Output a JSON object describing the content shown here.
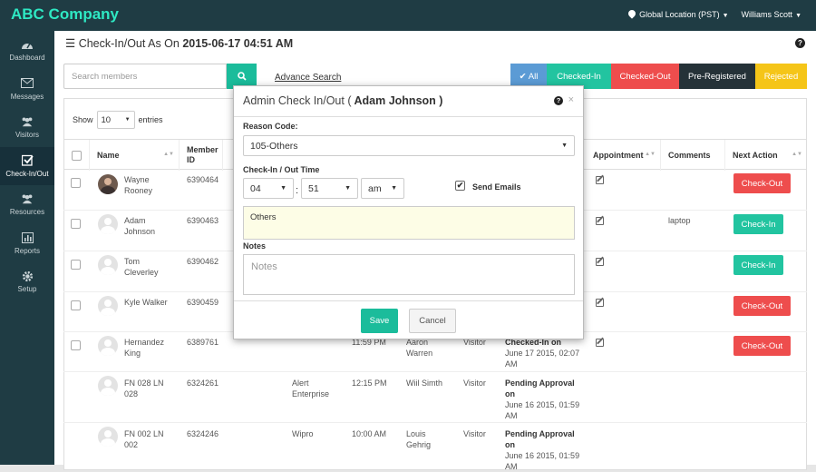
{
  "app": {
    "brand": "ABC Company",
    "location": "Global Location (PST)",
    "user": "Williams Scott"
  },
  "sidebar": {
    "items": [
      {
        "label": "Dashboard",
        "icon": "dashboard-icon"
      },
      {
        "label": "Messages",
        "icon": "envelope-icon"
      },
      {
        "label": "Visitors",
        "icon": "users-icon"
      },
      {
        "label": "Check-In/Out",
        "icon": "checkbox-icon"
      },
      {
        "label": "Resources",
        "icon": "resources-icon"
      },
      {
        "label": "Reports",
        "icon": "bar-chart-icon"
      },
      {
        "label": "Setup",
        "icon": "gear-icon"
      }
    ]
  },
  "page": {
    "title_prefix": "Check-In/Out As On",
    "title_datetime": "2015-06-17 04:51 AM"
  },
  "search": {
    "placeholder": "Search members",
    "advance_label": "Advance Search"
  },
  "filters": [
    {
      "label": "✔ All",
      "color": "#5b9bd5"
    },
    {
      "label": "Checked-In",
      "color": "#22c4a0"
    },
    {
      "label": "Checked-Out",
      "color": "#ee4d4d"
    },
    {
      "label": "Pre-Registered",
      "color": "#253238"
    },
    {
      "label": "Rejected",
      "color": "#f5c518"
    }
  ],
  "table": {
    "show_label": "Show",
    "entries_value": "10",
    "entries_label": "entries",
    "headers": {
      "name": "Name",
      "member_id": "Member ID",
      "appointment": "Appointment",
      "comments": "Comments",
      "next_action": "Next Action"
    },
    "rows": [
      {
        "name": "Wayne Rooney",
        "id": "6390464",
        "company": "",
        "time": "",
        "host": "",
        "type": "",
        "status": "",
        "status_date": "",
        "comment": "",
        "action": "Check-Out"
      },
      {
        "name": "Adam Johnson",
        "id": "6390463",
        "company": "",
        "time": "",
        "host": "",
        "type": "",
        "status": "",
        "status_date": "",
        "comment": "laptop",
        "action": "Check-In"
      },
      {
        "name": "Tom Cleverley",
        "id": "6390462",
        "company": "",
        "time": "",
        "host": "",
        "type": "",
        "status": "",
        "status_date": "",
        "comment": "",
        "action": "Check-In"
      },
      {
        "name": "Kyle Walker",
        "id": "6390459",
        "company": "",
        "time": "",
        "host": "",
        "type": "",
        "status": "",
        "status_date": "",
        "comment": "",
        "action": "Check-Out"
      },
      {
        "name": "Hernandez King",
        "id": "6389761",
        "company": "",
        "time": "11:59 PM",
        "host": "Aaron Warren",
        "type": "Visitor",
        "status": "Checked-In on",
        "status_date": "June 17 2015, 02:07 AM",
        "comment": "",
        "action": "Check-Out"
      },
      {
        "name": "FN 028 LN 028",
        "id": "6324261",
        "company": "Alert Enterprise",
        "time": "12:15 PM",
        "host": "Wiil Simth",
        "type": "Visitor",
        "status": "Pending Approval on",
        "status_date": "June 16 2015, 01:59 AM",
        "comment": "",
        "action": ""
      },
      {
        "name": "FN 002 LN 002",
        "id": "6324246",
        "company": "Wipro",
        "time": "10:00 AM",
        "host": "Louis Gehrig",
        "type": "Visitor",
        "status": "Pending Approval on",
        "status_date": "June 16 2015, 01:59 AM",
        "comment": "",
        "action": ""
      }
    ]
  },
  "modal": {
    "title": "Admin Check In/Out (",
    "person": " Adam Johnson )",
    "reason_label": "Reason Code:",
    "reason_value": "105-Others",
    "time_label": "Check-In / Out Time",
    "hour": "04",
    "minute": "51",
    "ampm": "am",
    "send_emails_label": "Send Emails",
    "send_emails_checked": "✔",
    "reason_text": "Others",
    "notes_label": "Notes",
    "notes_placeholder": "Notes",
    "save_label": "Save",
    "cancel_label": "Cancel"
  }
}
